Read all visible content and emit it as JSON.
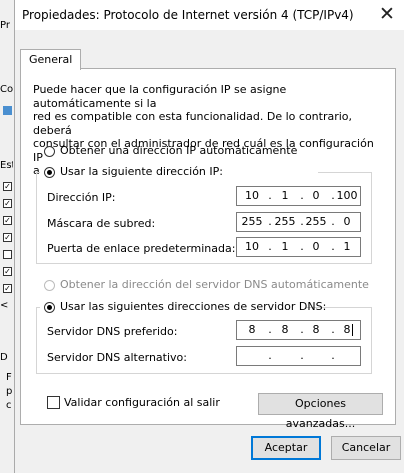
{
  "background": {
    "title_fragment": "Pr",
    "texts": [
      "Co",
      "Esta"
    ],
    "checkboxes": [
      true,
      true,
      true,
      true,
      false,
      true,
      true
    ],
    "scroll_arrow": "<",
    "bottom_fragments": [
      "D",
      "F",
      "p",
      "c"
    ]
  },
  "dialog": {
    "title": "Propiedades: Protocolo de Internet versión 4 (TCP/IPv4)",
    "close_glyph": "✕",
    "tab_label": "General",
    "description": "Puede hacer que la configuración IP se asigne automáticamente si la\nred es compatible con esta funcionalidad. De lo contrario, deberá\nconsultar con el administrador de red cuál es la configuración IP\napropiada.",
    "ip_auto_label": "Obtener una dirección IP automáticamente",
    "ip_manual_label": "Usar la siguiente dirección IP:",
    "ip_fields": {
      "address_label": "Dirección IP:",
      "address": [
        "10",
        "1",
        "0",
        "100"
      ],
      "mask_label": "Máscara de subred:",
      "mask": [
        "255",
        "255",
        "255",
        "0"
      ],
      "gateway_label": "Puerta de enlace predeterminada:",
      "gateway": [
        "10",
        "1",
        "0",
        "1"
      ]
    },
    "dns_auto_label": "Obtener la dirección del servidor DNS automáticamente",
    "dns_manual_label": "Usar las siguientes direcciones de servidor DNS:",
    "dns_fields": {
      "preferred_label": "Servidor DNS preferido:",
      "preferred": [
        "8",
        "8",
        "8",
        "8"
      ],
      "alternate_label": "Servidor DNS alternativo:",
      "alternate": [
        "",
        "",
        "",
        ""
      ]
    },
    "validate_label": "Validar configuración al salir",
    "advanced_button": "Opciones avanzadas...",
    "ok_button": "Aceptar",
    "cancel_button": "Cancelar"
  }
}
